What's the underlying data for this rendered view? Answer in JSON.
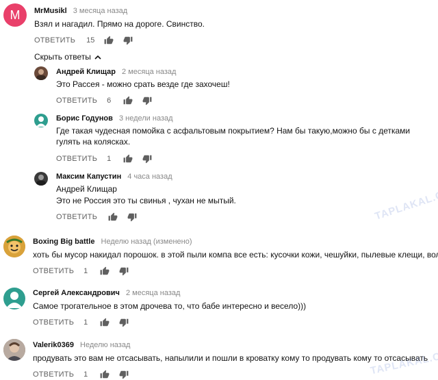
{
  "actions": {
    "reply_label": "ОТВЕТИТЬ"
  },
  "hide_replies_label": "Скрыть ответы",
  "watermark_text": "TAPLAKAL.COM",
  "comments": [
    {
      "author": "MrMusikl",
      "time": "3 месяца назад",
      "text": "Взял и нагадил. Прямо на дороге. Свинство.",
      "likes": "15",
      "avatar_letter": "M",
      "avatar_color": "#e9406a"
    },
    {
      "author": "Андрей Клищар",
      "time": "2 месяца назад",
      "text": "Это Рассея - можно срать везде где захочеш!",
      "likes": "6",
      "avatar_color": "#6b4a3a"
    },
    {
      "author": "Борис Годунов",
      "time": "3 недели назад",
      "text": "Где такая чудесная помойка с асфальтовым покрытием? Нам бы такую,можно бы с детками гулять на колясках.",
      "likes": "1",
      "avatar_color": "#2e9e8f"
    },
    {
      "author": "Максим Капустин",
      "time": "4 часа назад",
      "text_line1": "Андрей Клищар",
      "text_line2": "Это не Россия это ты свинья , чухан не мытый.",
      "likes": "",
      "avatar_color": "#3a3a3a"
    },
    {
      "author": "Boxing Big battle",
      "time": "Неделю назад (изменено)",
      "text": "хоть бы мусор накидал порошок. в этой пыли компа все есть: кусочки кожи, чешуйки, пылевые клещи, волосы.",
      "likes": "1",
      "avatar_color": "#c98a2a"
    },
    {
      "author": "Сергей Александрович",
      "time": "2 месяца назад",
      "text": "Самое трогательное в этом дрочева то, что бабе интересно и весело)))",
      "likes": "1",
      "avatar_color": "#2e9e8f"
    },
    {
      "author": "Valerik0369",
      "time": "Неделю назад",
      "text": "продувать это вам не отсасывать, напылили и пошли в кроватку кому то продувать кому то отсасывать",
      "likes": "1",
      "avatar_color": "#7a6a5e"
    }
  ]
}
